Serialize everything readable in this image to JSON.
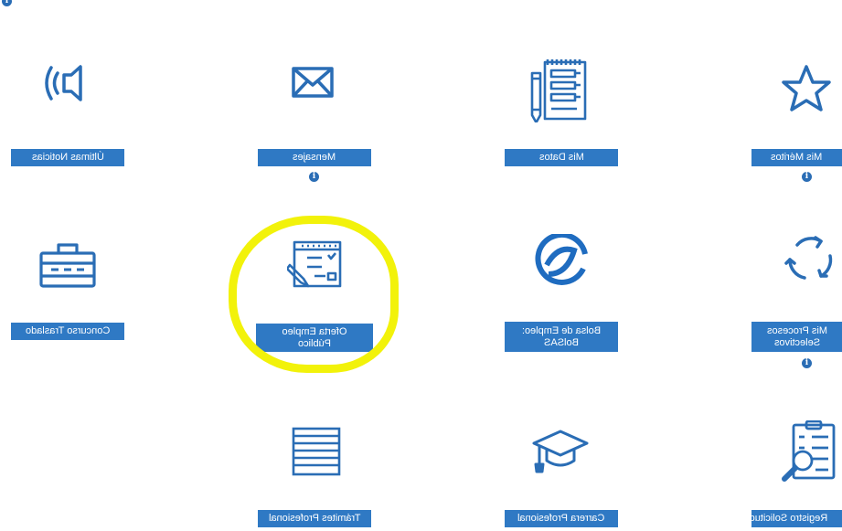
{
  "info_glyph": "i",
  "colors": {
    "button": "#2f79c4",
    "icon": "#2a6db5",
    "highlight": "#f2f20a"
  },
  "tiles": [
    {
      "label": "Últimas Noticias",
      "icon": "speaker-icon",
      "info": false
    },
    {
      "label": "Mensajes",
      "icon": "envelope-icon",
      "info": true
    },
    {
      "label": "Mis Datos",
      "icon": "notebook-icon",
      "info": false
    },
    {
      "label": "Mis Méritos",
      "icon": "star-icon",
      "info": true
    },
    {
      "label": "Concurso Traslado",
      "icon": "briefcase-icon",
      "info": false
    },
    {
      "label": "Oferta Empleo Público",
      "icon": "form-pencil-icon",
      "info": false
    },
    {
      "label": "Bolsa de Empleo: BolSAS",
      "icon": "bolsas-logo-icon",
      "info": false
    },
    {
      "label": "Mis Procesos Selectivos",
      "icon": "cycle-arrows-icon",
      "info": true
    },
    {
      "label": "Trámites Profesional",
      "icon": "document-lines-icon",
      "info": false
    },
    {
      "label": "Carrera Profesional",
      "icon": "graduation-cap-icon",
      "info": false
    },
    {
      "label": "Registro Solicitudes",
      "icon": "clipboard-magnifier-icon",
      "info": false
    }
  ]
}
